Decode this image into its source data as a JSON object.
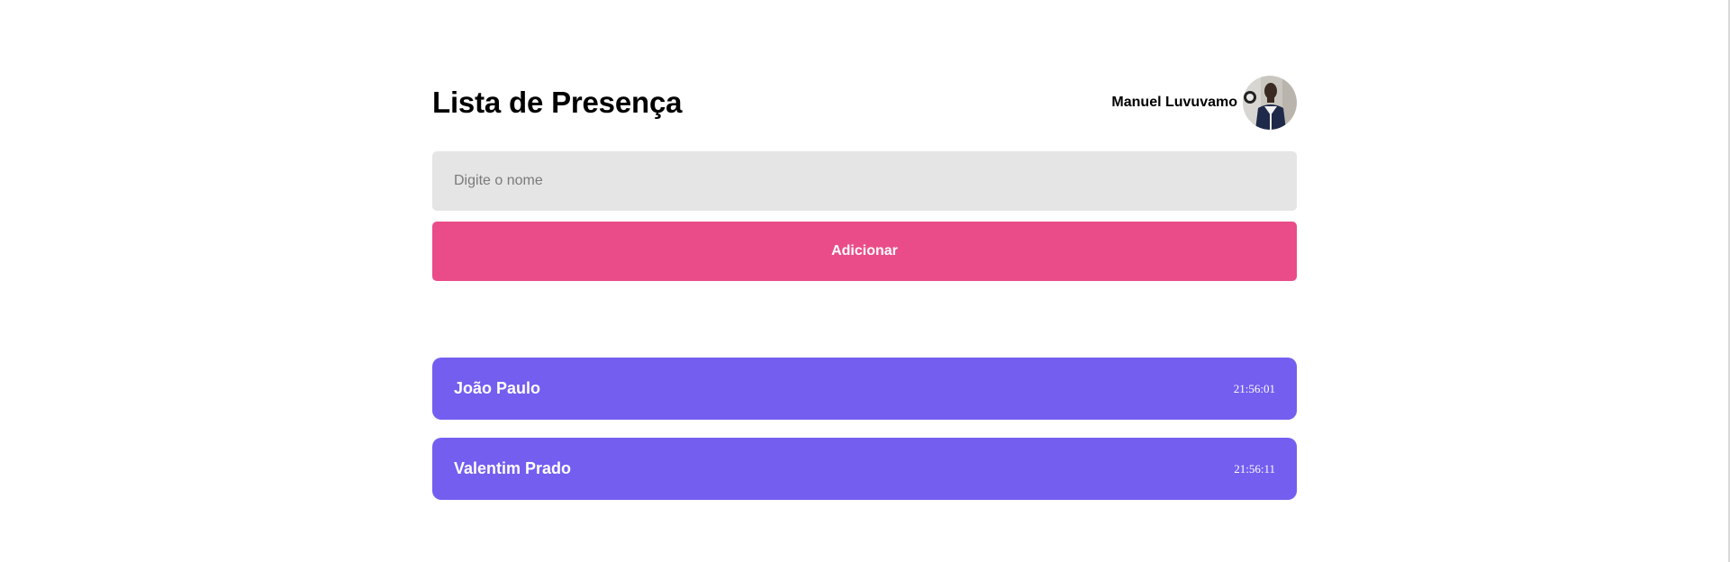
{
  "header": {
    "title": "Lista de Presença",
    "user_name": "Manuel Luvuvamo"
  },
  "form": {
    "name_placeholder": "Digite o nome",
    "add_label": "Adicionar"
  },
  "students": [
    {
      "name": "João Paulo",
      "time": "21:56:01"
    },
    {
      "name": "Valentim Prado",
      "time": "21:56:11"
    }
  ],
  "colors": {
    "accent_button": "#ea4c89",
    "card": "#735ef0",
    "input_bg": "#e5e5e5"
  }
}
